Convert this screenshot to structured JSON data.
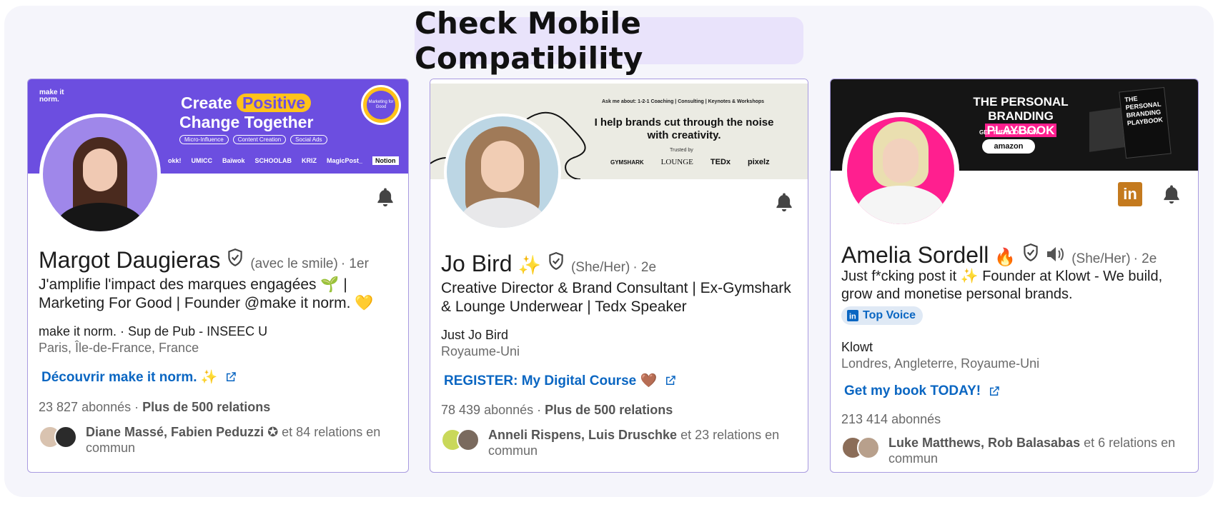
{
  "page": {
    "title": "Check Mobile Compatibility"
  },
  "cards": [
    {
      "banner": {
        "brand": "make it norm.",
        "line1_a": "Create",
        "line1_b": "Positive",
        "line2": "Change Together",
        "tags": [
          "Micro-Influence",
          "Content Creation",
          "Social Ads"
        ],
        "badge": "Marketing for Good",
        "logos": [
          "okk!",
          "UMICC",
          "Baïwok",
          "SCHOOLAB",
          "KRIZ",
          "MagicPost_",
          "Notion"
        ]
      },
      "name": "Margot Daugieras",
      "pronoun": "(avec le smile)",
      "degree": "· 1er",
      "headline": "J'amplifie l'impact des marques engagées 🌱 | Marketing For Good | Founder @make it norm. 💛",
      "company": "make it norm. · Sup de Pub - INSEEC U",
      "location": "Paris, Île-de-France, France",
      "link": "Découvrir make it norm. ✨",
      "followers_count": "23 827",
      "followers_label": "abonnés ·",
      "connections": "Plus de 500 relations",
      "mutual_names": "Diane Massé, Fabien Peduzzi ✪",
      "mutual_rest": "et 84 relations en commun"
    },
    {
      "banner": {
        "ask": "Ask me about: 1-2-1 Coaching | Consulting | Keynotes & Workshops",
        "main1": "I help brands cut through the noise",
        "main2": "with creativity.",
        "trusted": "Trusted by",
        "logos": [
          "GYMSHARK",
          "LOUNGE",
          "TEDx",
          "pixelz"
        ]
      },
      "name": "Jo Bird",
      "emoji": "✨",
      "pronoun": "(She/Her)",
      "degree": "· 2e",
      "headline": "Creative Director & Brand Consultant | Ex-Gymshark & Lounge Underwear | Tedx Speaker",
      "company": "Just Jo Bird",
      "location": "Royaume-Uni",
      "link": "REGISTER: My Digital Course 🤎",
      "followers_count": "78 439",
      "followers_label": "abonnés ·",
      "connections": "Plus de 500 relations",
      "mutual_names": "Anneli Rispens, Luis Druschke",
      "mutual_rest": "et 23 relations en commun"
    },
    {
      "banner": {
        "line1": "THE PERSONAL",
        "line2a": "BRANDING",
        "line2b": "PLAYBOOK",
        "cta": "GET THE BOOK NOW",
        "button": "amazon",
        "book": "PERSONAL BRANDING PLAYBOOK",
        "book_title": "THE"
      },
      "name": "Amelia Sordell",
      "emoji": "🔥",
      "pronoun": "(She/Her)",
      "degree": "· 2e",
      "headline": "Just f*cking post it ✨ Founder at Klowt - We build, grow and monetise personal brands.",
      "top_voice": "Top Voice",
      "company": "Klowt",
      "location": "Londres, Angleterre, Royaume-Uni",
      "link": "Get my book TODAY!",
      "followers_count": "213 414",
      "followers_label": "abonnés",
      "mutual_names": "Luke Matthews, Rob Balasabas",
      "mutual_rest": "et 6 relations en commun"
    }
  ],
  "colors": {
    "purple": "#6c4ee0",
    "yellow": "#ffc21a",
    "link": "#0a66c2",
    "pink": "#ff1f8f",
    "border": "#a99be0"
  }
}
